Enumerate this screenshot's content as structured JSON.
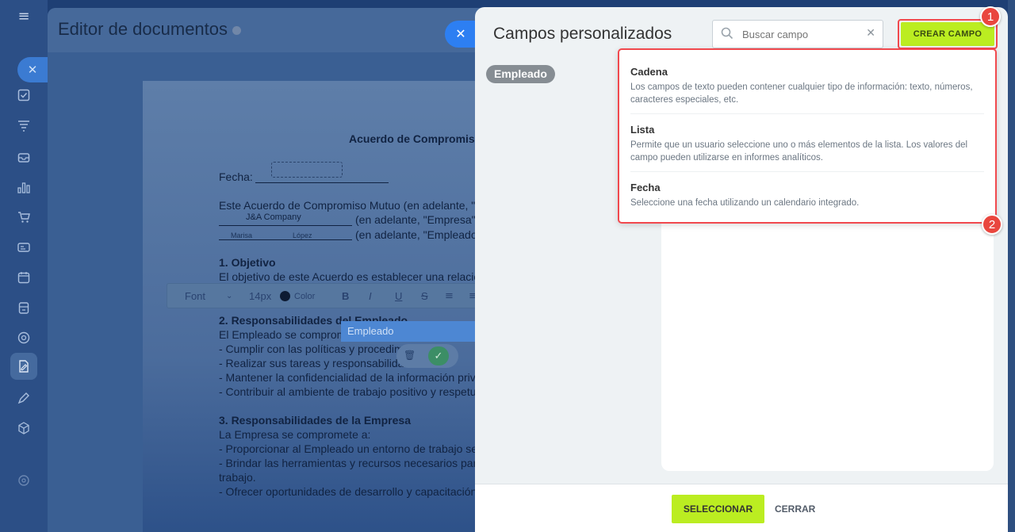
{
  "editor": {
    "title": "Editor de documentos",
    "document": {
      "heading": "Acuerdo de Compromiso",
      "fecha_label": "Fecha:",
      "intro": "Este Acuerdo de Compromiso Mutuo (en adelante, \"A",
      "company_field": "J&A Company",
      "company_suffix": "(en adelante, \"Empresa\")",
      "employee_first": "Marisa",
      "employee_last": "López",
      "employee_suffix": "(en adelante, \"Empleado",
      "s1_title": "1. Objetivo",
      "s1_text": "El objetivo de este Acuerdo es establecer una relació",
      "s2_title": "2. Responsabilidades del Empleado",
      "s2_intro": "El Empleado se compromete",
      "s2_items": [
        "- Cumplir con las políticas y procedim",
        "- Realizar sus tareas y responsabilida",
        "- Mantener la confidencialidad de la información privi",
        "- Contribuir al ambiente de trabajo positivo y respetu"
      ],
      "s3_title": "3. Responsabilidades de la Empresa",
      "s3_intro": "La Empresa se compromete a:",
      "s3_items": [
        "- Proporcionar al Empleado un entorno de trabajo se",
        "- Brindar las herramientas y recursos necesarios par",
        "trabajo.",
        "- Ofrecer oportunidades de desarrollo y capacitación"
      ]
    },
    "toolbar": {
      "font": "Font",
      "size": "14px",
      "color": "Color",
      "bold": "B",
      "italic": "I",
      "underline": "U",
      "strike": "S"
    },
    "employee_chip": "Empleado"
  },
  "panel": {
    "title": "Campos personalizados",
    "search_placeholder": "Buscar campo",
    "create_button": "CREAR CAMPO",
    "selected_chip": "Empleado",
    "options": [
      {
        "title": "Cadena",
        "description": "Los campos de texto pueden contener cualquier tipo de información: texto, números, caracteres especiales, etc."
      },
      {
        "title": "Lista",
        "description": "Permite que un usuario seleccione uno o más elementos de la lista. Los valores del campo pueden utilizarse en informes analíticos."
      },
      {
        "title": "Fecha",
        "description": "Seleccione una fecha utilizando un calendario integrado."
      }
    ],
    "select_button": "SELECCIONAR",
    "close_button": "CERRAR"
  },
  "badges": [
    "1",
    "2"
  ],
  "colors": {
    "accent_green": "#bbed21",
    "highlight_red": "#f1494e",
    "badge_red": "#e9463e",
    "chip_gray": "#868d93"
  },
  "icons": [
    "menu-icon",
    "tasks-icon",
    "funnel-icon",
    "inbox-icon",
    "analytics-icon",
    "cart-icon",
    "card-icon",
    "calendar-icon",
    "building-icon",
    "target-icon",
    "document-sign-icon",
    "pen-icon",
    "cube-icon",
    "search-icon",
    "close-icon"
  ]
}
